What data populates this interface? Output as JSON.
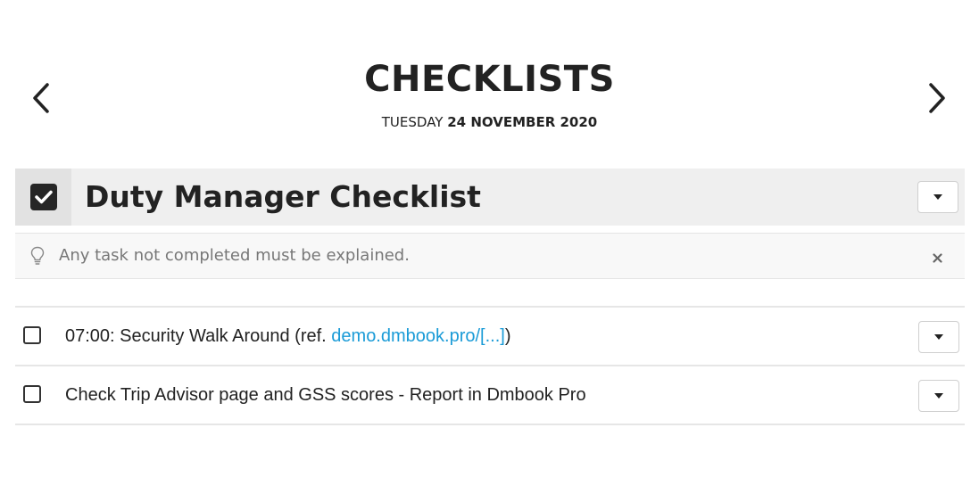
{
  "header": {
    "title": "CHECKLISTS",
    "day": "TUESDAY",
    "date": "24 NOVEMBER 2020"
  },
  "icons": {
    "prev": "chevron-left-icon",
    "next": "chevron-right-icon",
    "checked": "checkbox-checked-icon",
    "dropdown": "caret-down-icon",
    "hint": "lightbulb-icon",
    "close": "close-icon"
  },
  "colors": {
    "link": "#1a9bd7",
    "header_bar": "#efefef",
    "check_cell": "#e2e2e2",
    "notice_text": "#777777"
  },
  "checklist": {
    "title": "Duty Manager Checklist",
    "checked": true,
    "notice": "Any task not completed must be explained."
  },
  "tasks": [
    {
      "text": "07:00: Security Walk Around (ref. ",
      "link": "demo.dmbook.pro/[...]",
      "suffix": ")",
      "checked": false
    },
    {
      "text": "Check Trip Advisor page and GSS scores - Report in Dmbook Pro",
      "link": "",
      "suffix": "",
      "checked": false
    }
  ]
}
